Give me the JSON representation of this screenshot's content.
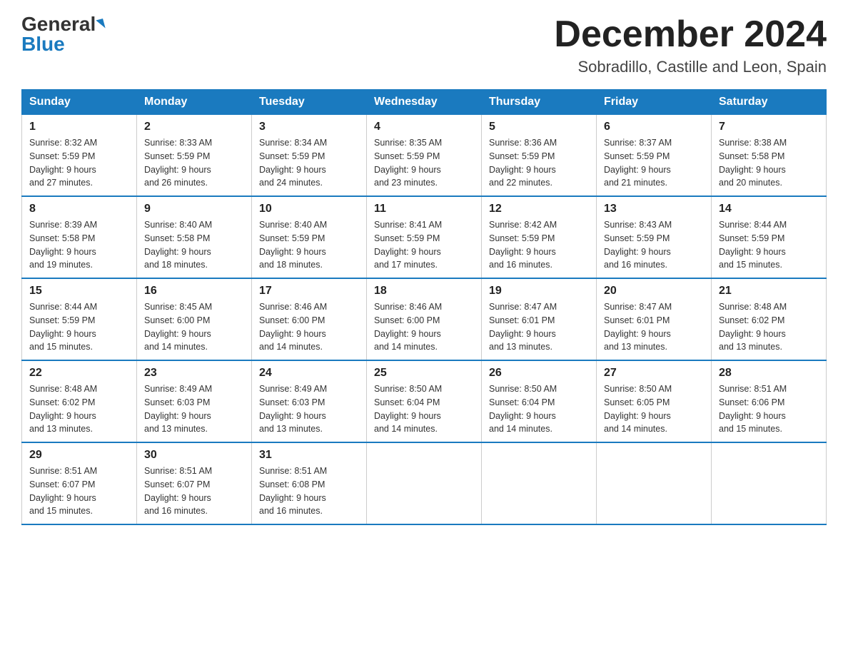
{
  "header": {
    "logo_general": "General",
    "logo_blue": "Blue",
    "month_title": "December 2024",
    "location": "Sobradillo, Castille and Leon, Spain"
  },
  "days_of_week": [
    "Sunday",
    "Monday",
    "Tuesday",
    "Wednesday",
    "Thursday",
    "Friday",
    "Saturday"
  ],
  "weeks": [
    [
      {
        "day": "1",
        "sunrise": "8:32 AM",
        "sunset": "5:59 PM",
        "daylight": "9 hours and 27 minutes."
      },
      {
        "day": "2",
        "sunrise": "8:33 AM",
        "sunset": "5:59 PM",
        "daylight": "9 hours and 26 minutes."
      },
      {
        "day": "3",
        "sunrise": "8:34 AM",
        "sunset": "5:59 PM",
        "daylight": "9 hours and 24 minutes."
      },
      {
        "day": "4",
        "sunrise": "8:35 AM",
        "sunset": "5:59 PM",
        "daylight": "9 hours and 23 minutes."
      },
      {
        "day": "5",
        "sunrise": "8:36 AM",
        "sunset": "5:59 PM",
        "daylight": "9 hours and 22 minutes."
      },
      {
        "day": "6",
        "sunrise": "8:37 AM",
        "sunset": "5:59 PM",
        "daylight": "9 hours and 21 minutes."
      },
      {
        "day": "7",
        "sunrise": "8:38 AM",
        "sunset": "5:58 PM",
        "daylight": "9 hours and 20 minutes."
      }
    ],
    [
      {
        "day": "8",
        "sunrise": "8:39 AM",
        "sunset": "5:58 PM",
        "daylight": "9 hours and 19 minutes."
      },
      {
        "day": "9",
        "sunrise": "8:40 AM",
        "sunset": "5:58 PM",
        "daylight": "9 hours and 18 minutes."
      },
      {
        "day": "10",
        "sunrise": "8:40 AM",
        "sunset": "5:59 PM",
        "daylight": "9 hours and 18 minutes."
      },
      {
        "day": "11",
        "sunrise": "8:41 AM",
        "sunset": "5:59 PM",
        "daylight": "9 hours and 17 minutes."
      },
      {
        "day": "12",
        "sunrise": "8:42 AM",
        "sunset": "5:59 PM",
        "daylight": "9 hours and 16 minutes."
      },
      {
        "day": "13",
        "sunrise": "8:43 AM",
        "sunset": "5:59 PM",
        "daylight": "9 hours and 16 minutes."
      },
      {
        "day": "14",
        "sunrise": "8:44 AM",
        "sunset": "5:59 PM",
        "daylight": "9 hours and 15 minutes."
      }
    ],
    [
      {
        "day": "15",
        "sunrise": "8:44 AM",
        "sunset": "5:59 PM",
        "daylight": "9 hours and 15 minutes."
      },
      {
        "day": "16",
        "sunrise": "8:45 AM",
        "sunset": "6:00 PM",
        "daylight": "9 hours and 14 minutes."
      },
      {
        "day": "17",
        "sunrise": "8:46 AM",
        "sunset": "6:00 PM",
        "daylight": "9 hours and 14 minutes."
      },
      {
        "day": "18",
        "sunrise": "8:46 AM",
        "sunset": "6:00 PM",
        "daylight": "9 hours and 14 minutes."
      },
      {
        "day": "19",
        "sunrise": "8:47 AM",
        "sunset": "6:01 PM",
        "daylight": "9 hours and 13 minutes."
      },
      {
        "day": "20",
        "sunrise": "8:47 AM",
        "sunset": "6:01 PM",
        "daylight": "9 hours and 13 minutes."
      },
      {
        "day": "21",
        "sunrise": "8:48 AM",
        "sunset": "6:02 PM",
        "daylight": "9 hours and 13 minutes."
      }
    ],
    [
      {
        "day": "22",
        "sunrise": "8:48 AM",
        "sunset": "6:02 PM",
        "daylight": "9 hours and 13 minutes."
      },
      {
        "day": "23",
        "sunrise": "8:49 AM",
        "sunset": "6:03 PM",
        "daylight": "9 hours and 13 minutes."
      },
      {
        "day": "24",
        "sunrise": "8:49 AM",
        "sunset": "6:03 PM",
        "daylight": "9 hours and 13 minutes."
      },
      {
        "day": "25",
        "sunrise": "8:50 AM",
        "sunset": "6:04 PM",
        "daylight": "9 hours and 14 minutes."
      },
      {
        "day": "26",
        "sunrise": "8:50 AM",
        "sunset": "6:04 PM",
        "daylight": "9 hours and 14 minutes."
      },
      {
        "day": "27",
        "sunrise": "8:50 AM",
        "sunset": "6:05 PM",
        "daylight": "9 hours and 14 minutes."
      },
      {
        "day": "28",
        "sunrise": "8:51 AM",
        "sunset": "6:06 PM",
        "daylight": "9 hours and 15 minutes."
      }
    ],
    [
      {
        "day": "29",
        "sunrise": "8:51 AM",
        "sunset": "6:07 PM",
        "daylight": "9 hours and 15 minutes."
      },
      {
        "day": "30",
        "sunrise": "8:51 AM",
        "sunset": "6:07 PM",
        "daylight": "9 hours and 16 minutes."
      },
      {
        "day": "31",
        "sunrise": "8:51 AM",
        "sunset": "6:08 PM",
        "daylight": "9 hours and 16 minutes."
      },
      null,
      null,
      null,
      null
    ]
  ]
}
